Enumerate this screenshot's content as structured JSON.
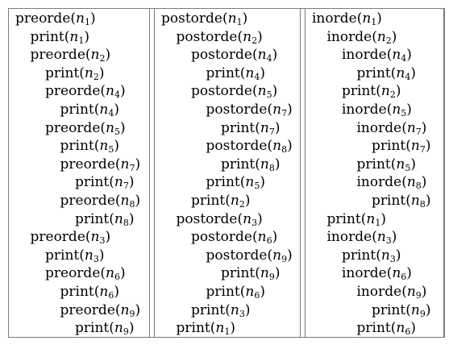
{
  "columns": [
    {
      "name": "preorde-column",
      "lines": [
        {
          "fn": "preorde",
          "node": "n",
          "index": "1",
          "depth": 0
        },
        {
          "fn": "print",
          "node": "n",
          "index": "1",
          "depth": 1
        },
        {
          "fn": "preorde",
          "node": "n",
          "index": "2",
          "depth": 1
        },
        {
          "fn": "print",
          "node": "n",
          "index": "2",
          "depth": 2
        },
        {
          "fn": "preorde",
          "node": "n",
          "index": "4",
          "depth": 2
        },
        {
          "fn": "print",
          "node": "n",
          "index": "4",
          "depth": 3
        },
        {
          "fn": "preorde",
          "node": "n",
          "index": "5",
          "depth": 2
        },
        {
          "fn": "print",
          "node": "n",
          "index": "5",
          "depth": 3
        },
        {
          "fn": "preorde",
          "node": "n",
          "index": "7",
          "depth": 3
        },
        {
          "fn": "print",
          "node": "n",
          "index": "7",
          "depth": 4
        },
        {
          "fn": "preorde",
          "node": "n",
          "index": "8",
          "depth": 3
        },
        {
          "fn": "print",
          "node": "n",
          "index": "8",
          "depth": 4
        },
        {
          "fn": "preorde",
          "node": "n",
          "index": "3",
          "depth": 1
        },
        {
          "fn": "print",
          "node": "n",
          "index": "3",
          "depth": 2
        },
        {
          "fn": "preorde",
          "node": "n",
          "index": "6",
          "depth": 2
        },
        {
          "fn": "print",
          "node": "n",
          "index": "6",
          "depth": 3
        },
        {
          "fn": "preorde",
          "node": "n",
          "index": "9",
          "depth": 3
        },
        {
          "fn": "print",
          "node": "n",
          "index": "9",
          "depth": 4
        }
      ]
    },
    {
      "name": "postorde-column",
      "lines": [
        {
          "fn": "postorde",
          "node": "n",
          "index": "1",
          "depth": 0
        },
        {
          "fn": "postorde",
          "node": "n",
          "index": "2",
          "depth": 1
        },
        {
          "fn": "postorde",
          "node": "n",
          "index": "4",
          "depth": 2
        },
        {
          "fn": "print",
          "node": "n",
          "index": "4",
          "depth": 3
        },
        {
          "fn": "postorde",
          "node": "n",
          "index": "5",
          "depth": 2
        },
        {
          "fn": "postorde",
          "node": "n",
          "index": "7",
          "depth": 3
        },
        {
          "fn": "print",
          "node": "n",
          "index": "7",
          "depth": 4
        },
        {
          "fn": "postorde",
          "node": "n",
          "index": "8",
          "depth": 3
        },
        {
          "fn": "print",
          "node": "n",
          "index": "8",
          "depth": 4
        },
        {
          "fn": "print",
          "node": "n",
          "index": "5",
          "depth": 3
        },
        {
          "fn": "print",
          "node": "n",
          "index": "2",
          "depth": 2
        },
        {
          "fn": "postorde",
          "node": "n",
          "index": "3",
          "depth": 1
        },
        {
          "fn": "postorde",
          "node": "n",
          "index": "6",
          "depth": 2
        },
        {
          "fn": "postorde",
          "node": "n",
          "index": "9",
          "depth": 3
        },
        {
          "fn": "print",
          "node": "n",
          "index": "9",
          "depth": 4
        },
        {
          "fn": "print",
          "node": "n",
          "index": "6",
          "depth": 3
        },
        {
          "fn": "print",
          "node": "n",
          "index": "3",
          "depth": 2
        },
        {
          "fn": "print",
          "node": "n",
          "index": "1",
          "depth": 1
        }
      ]
    },
    {
      "name": "inorde-column",
      "lines": [
        {
          "fn": "inorde",
          "node": "n",
          "index": "1",
          "depth": 0
        },
        {
          "fn": "inorde",
          "node": "n",
          "index": "2",
          "depth": 1
        },
        {
          "fn": "inorde",
          "node": "n",
          "index": "4",
          "depth": 2
        },
        {
          "fn": "print",
          "node": "n",
          "index": "4",
          "depth": 3
        },
        {
          "fn": "print",
          "node": "n",
          "index": "2",
          "depth": 2
        },
        {
          "fn": "inorde",
          "node": "n",
          "index": "5",
          "depth": 2
        },
        {
          "fn": "inorde",
          "node": "n",
          "index": "7",
          "depth": 3
        },
        {
          "fn": "print",
          "node": "n",
          "index": "7",
          "depth": 4
        },
        {
          "fn": "print",
          "node": "n",
          "index": "5",
          "depth": 3
        },
        {
          "fn": "inorde",
          "node": "n",
          "index": "8",
          "depth": 3
        },
        {
          "fn": "print",
          "node": "n",
          "index": "8",
          "depth": 4
        },
        {
          "fn": "print",
          "node": "n",
          "index": "1",
          "depth": 1
        },
        {
          "fn": "inorde",
          "node": "n",
          "index": "3",
          "depth": 1
        },
        {
          "fn": "print",
          "node": "n",
          "index": "3",
          "depth": 2
        },
        {
          "fn": "inorde",
          "node": "n",
          "index": "6",
          "depth": 2
        },
        {
          "fn": "inorde",
          "node": "n",
          "index": "9",
          "depth": 3
        },
        {
          "fn": "print",
          "node": "n",
          "index": "9",
          "depth": 4
        },
        {
          "fn": "print",
          "node": "n",
          "index": "6",
          "depth": 3
        }
      ]
    }
  ]
}
